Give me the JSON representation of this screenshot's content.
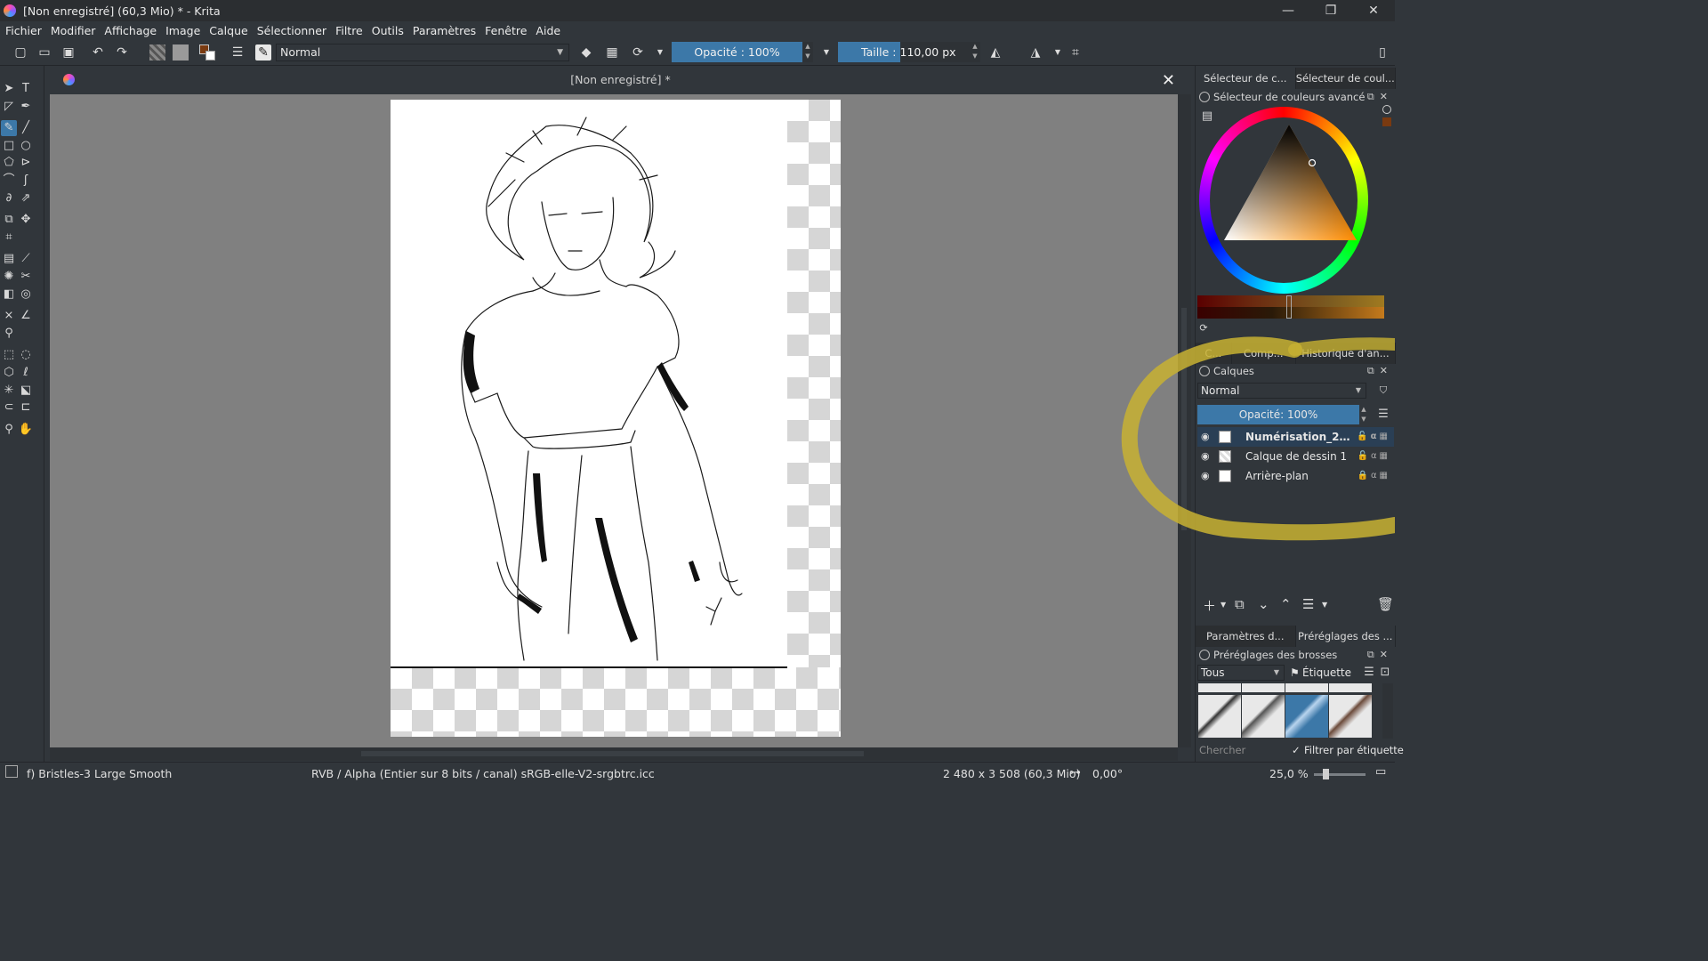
{
  "window": {
    "title": "[Non enregistré]  (60,3 Mio)  * - Krita",
    "controls": [
      "—",
      "❐",
      "✕"
    ]
  },
  "menu": [
    "Fichier",
    "Modifier",
    "Affichage",
    "Image",
    "Calque",
    "Sélectionner",
    "Filtre",
    "Outils",
    "Paramètres",
    "Fenêtre",
    "Aide"
  ],
  "toolbar": {
    "blend_mode": "Normal",
    "opacity_label": "Opacité : 100%",
    "size_label": "Taille :",
    "size_value": "110,00 px"
  },
  "document": {
    "tab_title": "[Non enregistré]  *"
  },
  "dock": {
    "top_tabs": [
      "Sélecteur de c...",
      "Sélecteur de coul..."
    ],
    "color_panel_title": "Sélecteur de couleurs avancé",
    "mid_tabs": [
      "C...",
      "Comp...",
      "Historique d'an..."
    ],
    "layers_title": "Calques",
    "layers_blend": "Normal",
    "layers_opacity": "Opacité:  100%",
    "layers": [
      {
        "name": "Numérisation_2024...",
        "selected": true
      },
      {
        "name": "Calque de dessin 1",
        "selected": false
      },
      {
        "name": "Arrière-plan",
        "selected": false
      }
    ],
    "bottom_tabs": [
      "Paramètres d...",
      "Préréglages des ..."
    ],
    "brushes_title": "Préréglages des brosses",
    "brushes_filter": "Tous",
    "brushes_tag": "Étiquette",
    "search_placeholder": "Chercher",
    "filter_by_tag": "Filtrer par étiquette"
  },
  "status": {
    "brush": "f) Bristles-3 Large Smooth",
    "color_space": "RVB / Alpha (Entier sur 8 bits / canal)  sRGB-elle-V2-srgbtrc.icc",
    "image_size": "2 480 x 3 508 (60,3 Mio)",
    "rotation": "0,00°",
    "zoom": "25,0 %"
  },
  "colors": {
    "accent": "#3c78a8",
    "annotation": "#c8b232"
  }
}
